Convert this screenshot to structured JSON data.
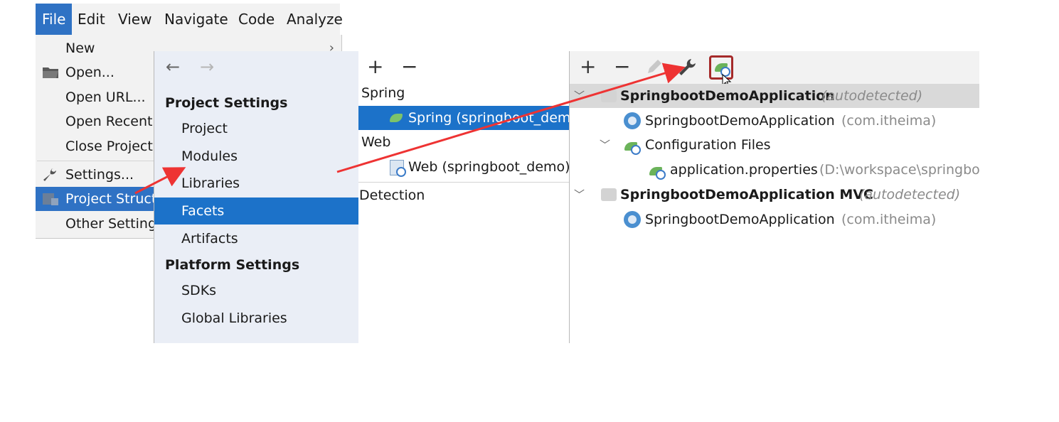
{
  "menubar": {
    "items": [
      "File",
      "Edit",
      "View",
      "Navigate",
      "Code",
      "Analyze"
    ]
  },
  "file_menu": {
    "items": [
      {
        "label": "New",
        "icon": ""
      },
      {
        "label": "Open...",
        "icon": "folder-icon"
      },
      {
        "label": "Open URL...",
        "icon": ""
      },
      {
        "label": "Open Recent",
        "icon": ""
      },
      {
        "label": "Close Project",
        "icon": ""
      },
      {
        "label": "Settings...",
        "icon": "wrench-icon"
      },
      {
        "label": "Project Struct",
        "icon": "project-structure-icon"
      },
      {
        "label": "Other Setting",
        "icon": ""
      }
    ]
  },
  "project_structure": {
    "nav": {
      "back": "←",
      "forward": "→"
    },
    "project_settings_header": "Project Settings",
    "project_items": [
      "Project",
      "Modules",
      "Libraries",
      "Facets",
      "Artifacts"
    ],
    "platform_settings_header": "Platform Settings",
    "platform_items": [
      "SDKs",
      "Global Libraries"
    ]
  },
  "facets_panel": {
    "add": "+",
    "remove": "−",
    "group_spring": "Spring",
    "spring_item": "Spring (springboot_demo)",
    "group_web": "Web",
    "web_item": "Web (springboot_demo)",
    "detection": "Detection"
  },
  "config_panel": {
    "add": "+",
    "remove": "−",
    "rows": {
      "ctx1_name": "SpringbootDemoApplication",
      "ctx1_tag": "(autodetected)",
      "ctx1_child_name": "SpringbootDemoApplication",
      "ctx1_child_pkg": "(com.itheima)",
      "config_files": "Configuration Files",
      "props_name": "application.properties",
      "props_path": "(D:\\workspace\\springbo",
      "ctx2_name": "SpringbootDemoApplication MVC",
      "ctx2_tag": "(autodetected)",
      "ctx2_child_name": "SpringbootDemoApplication",
      "ctx2_child_pkg": "(com.itheima)"
    }
  },
  "colors": {
    "accent": "#1c72c9",
    "menu_highlight": "#2f72c4",
    "annotation_arrow": "#ee3333",
    "highlight_box": "#a52a2a",
    "spring_green": "#6bb35a"
  }
}
